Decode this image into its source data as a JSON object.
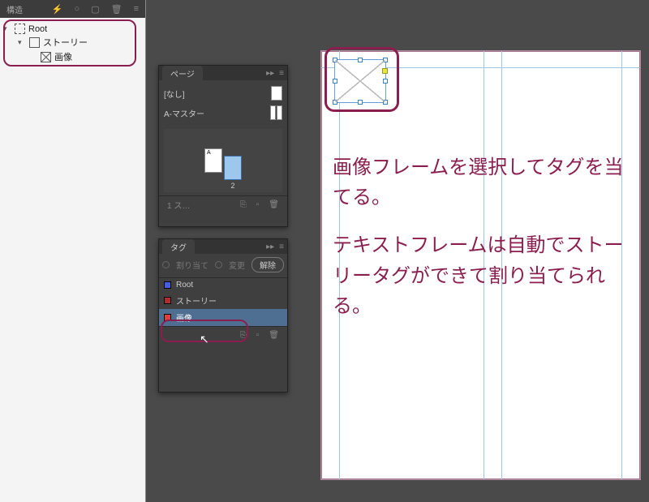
{
  "structure": {
    "panel_title": "構造",
    "root_label": "Root",
    "story_label": "ストーリー",
    "image_label": "画像"
  },
  "pages_panel": {
    "tab": "ページ",
    "none_label": "[なし]",
    "master_label": "A-マスター",
    "page_a_letter": "A",
    "page_2_label": "2",
    "footer_text": "1 ス…"
  },
  "tags_panel": {
    "tab": "タグ",
    "assign_label": "割り当て",
    "change_label": "変更",
    "release_btn": "解除",
    "tags": [
      {
        "name": "Root",
        "swatch": "sw-blue",
        "selected": false
      },
      {
        "name": "ストーリー",
        "swatch": "sw-red1",
        "selected": false
      },
      {
        "name": "画像",
        "swatch": "sw-red2",
        "selected": true
      }
    ]
  },
  "annotations": {
    "para1": "画像フレームを選択してタグを当てる。",
    "para2": "テキストフレームは自動でストーリータグができて割り当てられる。"
  },
  "colors": {
    "annotation": "#8a1f4f"
  }
}
